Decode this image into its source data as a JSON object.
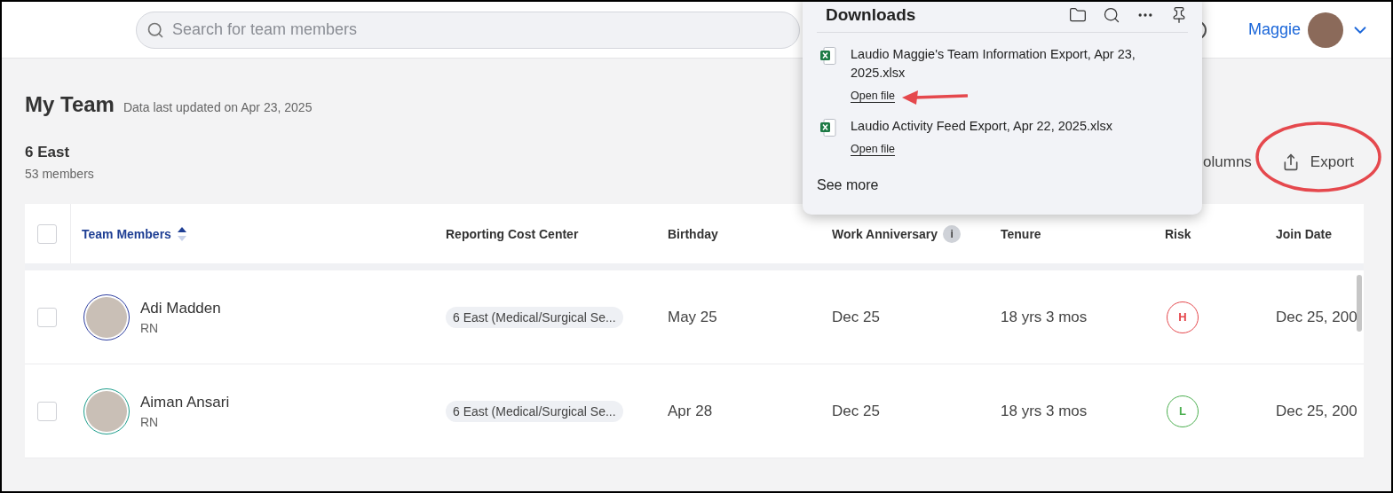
{
  "header": {
    "search": {
      "placeholder": "Search for team members"
    },
    "user": {
      "name": "Maggie"
    }
  },
  "page": {
    "title": "My Team",
    "updated": "Data last updated on Apr 23, 2025",
    "team": {
      "name": "6 East",
      "count": "53 members"
    },
    "columns_label": "olumns",
    "export_label": "Export"
  },
  "table": {
    "select_all": {
      "checked": false
    },
    "columns": [
      {
        "label": "Team Members",
        "sorted": true,
        "info": false
      },
      {
        "label": "Reporting Cost Center",
        "sorted": false,
        "info": false
      },
      {
        "label": "Birthday",
        "sorted": false,
        "info": false
      },
      {
        "label": "Work Anniversary",
        "sorted": false,
        "info": "i"
      },
      {
        "label": "Tenure",
        "sorted": false,
        "info": false
      },
      {
        "label": "Risk",
        "sorted": false,
        "info": false
      },
      {
        "label": "Join Date",
        "sorted": false,
        "info": false
      }
    ],
    "rows": [
      {
        "checked": false,
        "name": "Adi Madden",
        "role": "RN",
        "avatar": {
          "color": "#2f3fa0"
        },
        "cost_center": "6 East (Medical/Surgical Se...",
        "birthday": "May 25",
        "anniversary": "Dec 25",
        "tenure": "18 yrs 3 mos",
        "risk": {
          "label": "H",
          "color": "#e5484d"
        },
        "join_date": "Dec 25, 200"
      },
      {
        "checked": false,
        "name": "Aiman Ansari",
        "role": "RN",
        "avatar": {
          "color": "#1e9e8c"
        },
        "cost_center": "6 East (Medical/Surgical Se...",
        "birthday": "Apr 28",
        "anniversary": "Dec 25",
        "tenure": "18 yrs 3 mos",
        "risk": {
          "label": "L",
          "color": "#4caf50"
        },
        "join_date": "Dec 25, 200"
      }
    ]
  },
  "downloads": {
    "title": "Downloads",
    "items": [
      {
        "file": "Laudio Maggie's Team Information Export, Apr 23, 2025.xlsx",
        "action": "Open file"
      },
      {
        "file": "Laudio Activity Feed Export, Apr 22, 2025.xlsx",
        "action": "Open file"
      }
    ],
    "see_more": "See more"
  }
}
